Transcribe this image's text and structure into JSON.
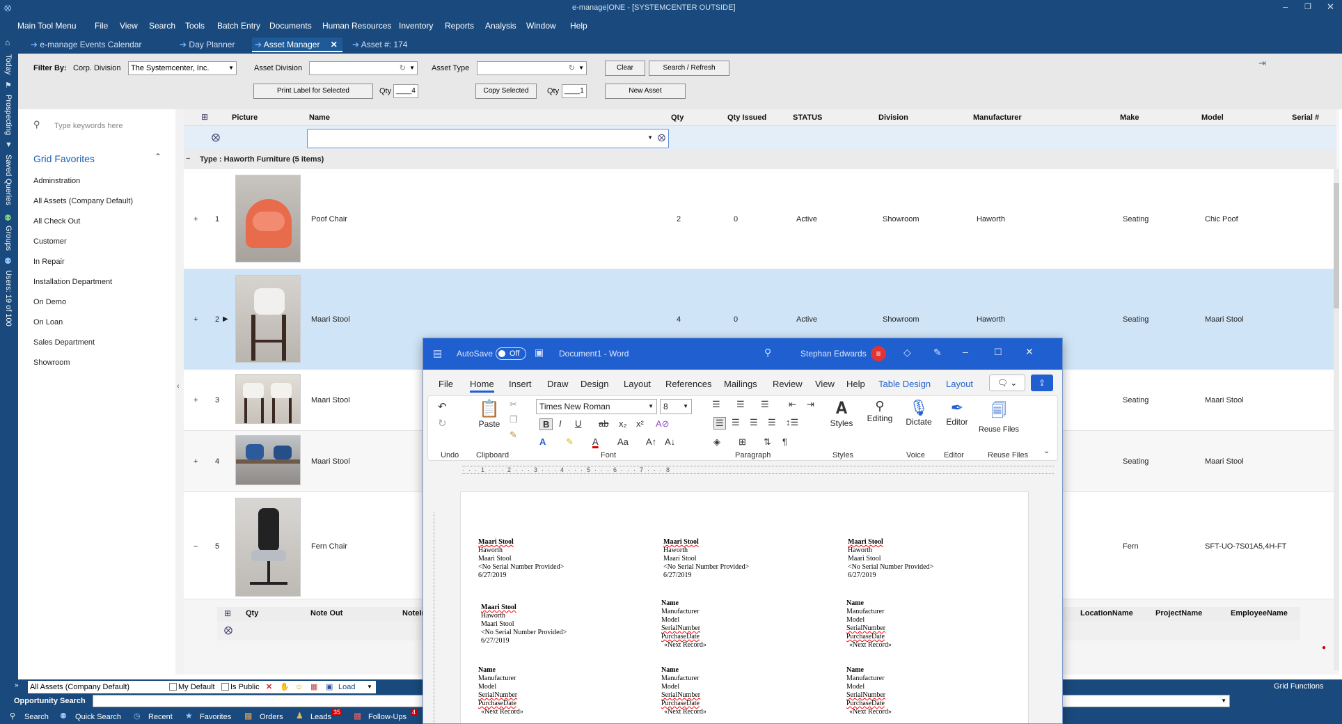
{
  "app": {
    "title": "e-manage|ONE - [SYSTEMCENTER OUTSIDE]"
  },
  "menu": [
    "Main Tool Menu",
    "File",
    "View",
    "Search",
    "Tools",
    "Batch Entry",
    "Documents",
    "Human Resources",
    "Inventory",
    "Reports",
    "Analysis",
    "Window",
    "Help"
  ],
  "tabs": [
    {
      "label": "e-manage Events Calendar"
    },
    {
      "label": "Day Planner"
    },
    {
      "label": "Asset Manager"
    },
    {
      "label": "Asset #: 174"
    }
  ],
  "rail": [
    "Today",
    "Prospecting",
    "Saved Queries",
    "Groups",
    "Users: 19 of 100"
  ],
  "filter": {
    "filter_by": "Filter By:",
    "corp_label": "Corp. Division",
    "corp_value": "The Systemcenter, Inc.",
    "asset_div_label": "Asset Division",
    "asset_type_label": "Asset Type",
    "clear": "Clear",
    "search_refresh": "Search / Refresh",
    "print_label": "Print Label for Selected",
    "qty_label": "Qty",
    "qty1": "____4",
    "copy_selected": "Copy Selected",
    "qty2": "____1",
    "new_asset": "New Asset"
  },
  "favorites": {
    "search_placeholder": "Type keywords here",
    "title": "Grid Favorites",
    "items": [
      "Adminstration",
      "All Assets (Company Default)",
      "All Check Out",
      "Customer",
      "In Repair",
      "Installation Department",
      "On Demo",
      "On Loan",
      "Sales Department",
      "Showroom"
    ]
  },
  "grid": {
    "headers": [
      "Picture",
      "Name",
      "Qty",
      "Qty Issued",
      "STATUS",
      "Division",
      "Manufacturer",
      "Make",
      "Model",
      "Serial #"
    ],
    "group_label": "Type : Haworth Furniture (5 items)",
    "rows": [
      {
        "num": "1",
        "name": "Poof Chair",
        "qty": "2",
        "issued": "0",
        "status": "Active",
        "division": "Showroom",
        "mfr": "Haworth",
        "make": "Seating",
        "model": "Chic Poof"
      },
      {
        "num": "2",
        "name": "Maari Stool",
        "qty": "4",
        "issued": "0",
        "status": "Active",
        "division": "Showroom",
        "mfr": "Haworth",
        "make": "Seating",
        "model": "Maari Stool"
      },
      {
        "num": "3",
        "name": "Maari Stool",
        "make": "Seating",
        "model": "Maari Stool"
      },
      {
        "num": "4",
        "name": "Maari Stool",
        "make": "Seating",
        "model": "Maari Stool"
      },
      {
        "num": "5",
        "name": "Fern Chair",
        "make": "Fern",
        "model": "SFT-UO-7S01A5,4H-FT"
      }
    ],
    "sub_headers": [
      "Qty",
      "Note Out",
      "NoteIn",
      "LocationName",
      "ProjectName",
      "EmployeeName"
    ]
  },
  "statusbar": {
    "layout_value": "All Assets (Company Default)",
    "my_default": "My Default",
    "is_public": "Is Public",
    "load": "Load",
    "grid_functions": "Grid Functions",
    "opportunity": "Opportunity Search",
    "nav": [
      {
        "label": "Search"
      },
      {
        "label": "Quick Search"
      },
      {
        "label": "Recent"
      },
      {
        "label": "Favorites"
      },
      {
        "label": "Orders"
      },
      {
        "label": "Leads",
        "badge": "35"
      },
      {
        "label": "Follow-Ups",
        "badge": "4"
      }
    ]
  },
  "word": {
    "autosave": "AutoSave",
    "off": "Off",
    "doc": "Document1 - Word",
    "user": "Stephan Edwards",
    "tabs": [
      "File",
      "Home",
      "Insert",
      "Draw",
      "Design",
      "Layout",
      "References",
      "Mailings",
      "Review",
      "View",
      "Help",
      "Table Design",
      "Layout"
    ],
    "font": "Times New Roman",
    "size": "8",
    "buttons": {
      "paste": "Paste",
      "styles": "Styles",
      "editing": "Editing",
      "dictate": "Dictate",
      "editor": "Editor",
      "reuse": "Reuse Files"
    },
    "groups": [
      "Undo",
      "Clipboard",
      "Font",
      "Paragraph",
      "Styles",
      "Voice",
      "Editor",
      "Reuse Files"
    ],
    "labels_filled": [
      [
        "Maari Stool",
        "Haworth",
        "Maari Stool",
        "<No Serial Number Provided>",
        "6/27/2019"
      ]
    ],
    "labels_template": [
      "Name",
      "Manufacturer",
      "Model",
      "SerialNumber",
      "PurchaseDate",
      "«Next Record»"
    ]
  }
}
